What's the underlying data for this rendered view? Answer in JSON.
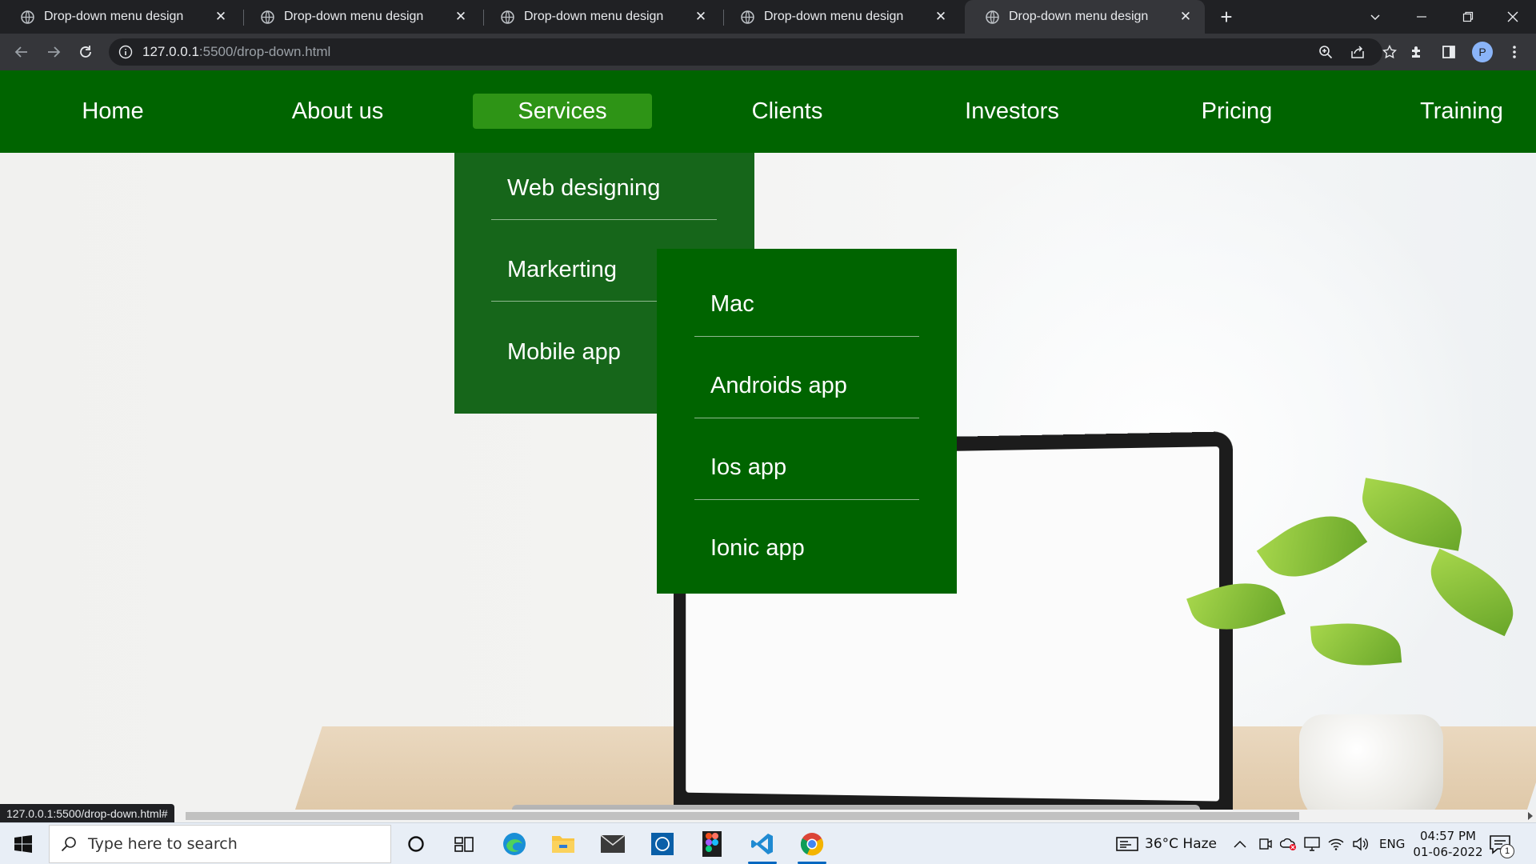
{
  "browser": {
    "tabs": [
      {
        "title": "Drop-down menu design",
        "active": false
      },
      {
        "title": "Drop-down menu design",
        "active": false
      },
      {
        "title": "Drop-down menu design",
        "active": false
      },
      {
        "title": "Drop-down menu design",
        "active": false
      },
      {
        "title": "Drop-down menu design",
        "active": true
      }
    ],
    "close_glyph": "✕",
    "new_tab_glyph": "+",
    "url_host": "127.0.0.1",
    "url_path": ":5500/drop-down.html",
    "profile_initial": "P",
    "status_url": "127.0.0.1:5500/drop-down.html#"
  },
  "page": {
    "nav": [
      "Home",
      "About us",
      "Services",
      "Clients",
      "Investors",
      "Pricing",
      "Training"
    ],
    "active_nav": "Services",
    "services_dropdown": [
      "Web designing",
      "Markerting",
      "Mobile app"
    ],
    "mobile_submenu": [
      "Mac",
      "Androids app",
      "Ios app",
      "Ionic app"
    ]
  },
  "taskbar": {
    "search_placeholder": "Type here to search",
    "weather": "36°C  Haze",
    "language": "ENG",
    "time": "04:57 PM",
    "date": "01-06-2022",
    "notification_count": "1",
    "pinned_icons": [
      "cortana-icon",
      "task-view-icon",
      "edge-icon",
      "file-explorer-icon",
      "mail-icon",
      "dell-icon",
      "figma-icon",
      "vscode-icon",
      "chrome-icon"
    ]
  },
  "colors": {
    "nav_bg": "#006400",
    "nav_active": "#2e9416",
    "dropdown_bg": "#16661a",
    "submenu_bg": "#006400"
  }
}
